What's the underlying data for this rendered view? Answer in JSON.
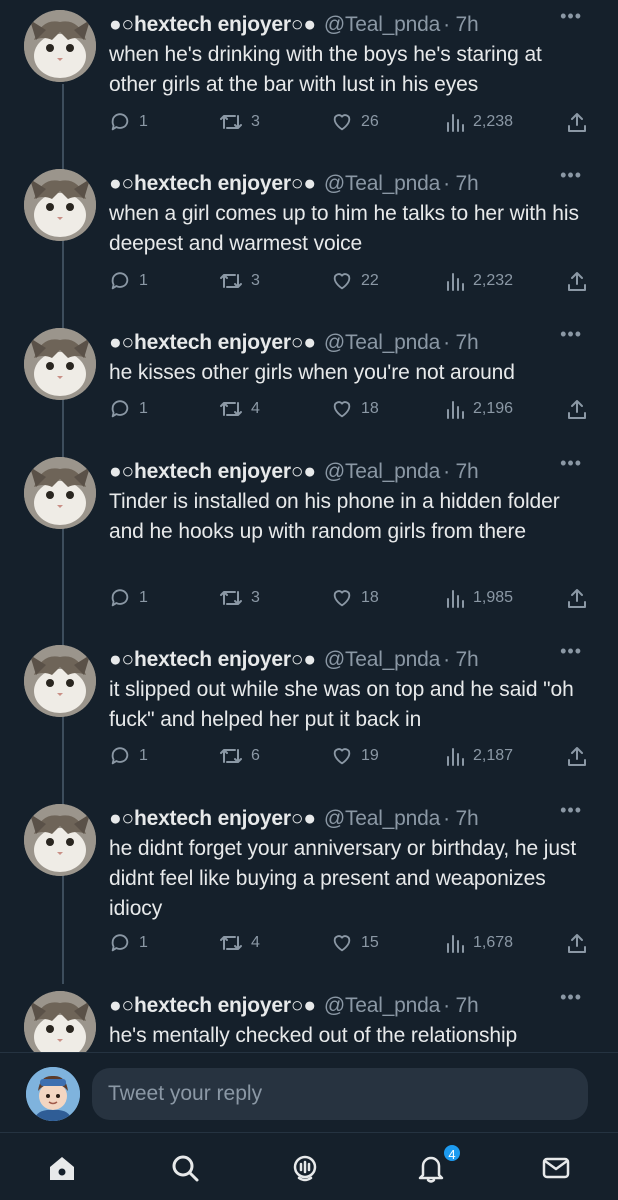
{
  "tweets": [
    {
      "name": "●○hextech enjoyer○●",
      "handle": "@Teal_pnda",
      "time": "· 7h",
      "text": "when he's drinking with the boys he's staring at other girls at the bar with lust in his eyes",
      "replies": "1",
      "retweets": "3",
      "likes": "26",
      "views": "2,238"
    },
    {
      "name": "●○hextech enjoyer○●",
      "handle": "@Teal_pnda",
      "time": "· 7h",
      "text": "when a girl comes up to him he talks to her with his deepest and warmest voice",
      "replies": "1",
      "retweets": "3",
      "likes": "22",
      "views": "2,232"
    },
    {
      "name": "●○hextech enjoyer○●",
      "handle": "@Teal_pnda",
      "time": "· 7h",
      "text": "he kisses other girls when you're not around",
      "replies": "1",
      "retweets": "4",
      "likes": "18",
      "views": "2,196"
    },
    {
      "name": "●○hextech enjoyer○●",
      "handle": "@Teal_pnda",
      "time": "· 7h",
      "text": "Tinder is installed on his phone in a hidden folder and he hooks up with random girls from there",
      "replies": "1",
      "retweets": "3",
      "likes": "18",
      "views": "1,985"
    },
    {
      "name": "●○hextech enjoyer○●",
      "handle": "@Teal_pnda",
      "time": "· 7h",
      "text": "it slipped out while she was on top and he said \"oh fuck\" and helped her put it back in",
      "replies": "1",
      "retweets": "6",
      "likes": "19",
      "views": "2,187"
    },
    {
      "name": "●○hextech enjoyer○●",
      "handle": "@Teal_pnda",
      "time": "· 7h",
      "text": "he didnt forget your anniversary or birthday, he just didnt feel like buying a present and weaponizes idiocy",
      "replies": "1",
      "retweets": "4",
      "likes": "15",
      "views": "1,678"
    },
    {
      "name": "●○hextech enjoyer○●",
      "handle": "@Teal_pnda",
      "time": "· 7h",
      "text": "he's mentally checked out of the relationship",
      "replies": "",
      "retweets": "",
      "likes": "",
      "views": ""
    }
  ],
  "more_label": "•••",
  "reply_bar": {
    "placeholder": "Tweet your reply"
  },
  "tabbar": {
    "items": [
      "home-icon",
      "search-icon",
      "spaces-icon",
      "notifications-icon",
      "messages-icon"
    ],
    "notification_count": "4"
  },
  "colors": {
    "background": "#15202b",
    "text": "#e7e9ea",
    "muted": "#8b98a5",
    "accent": "#1d9bf0",
    "thread_line": "#3d4d5c"
  }
}
